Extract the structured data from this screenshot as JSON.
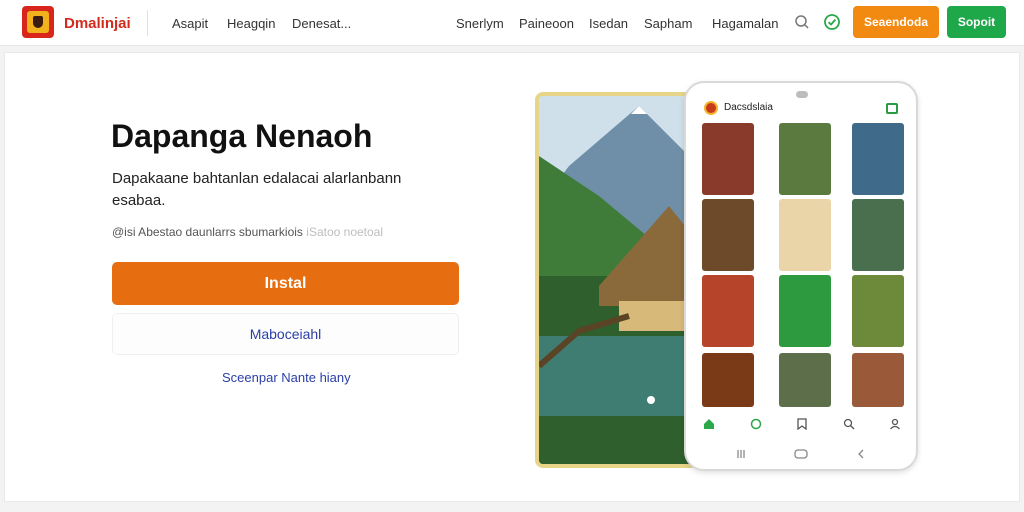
{
  "header": {
    "brand": "Dmalinjai",
    "links_left": [
      "Asapit",
      "Heagqin",
      "Denesat..."
    ],
    "links_right": [
      "Snerlym",
      "Paineoon",
      "Isedan",
      "Sapham",
      "Hagamalan"
    ],
    "cta_orange": "Seaendoda",
    "cta_green": "Sopoit"
  },
  "hero": {
    "title": "Dapanga Nenaoh",
    "description": "Dapakaane bahtanlan edalacai alarlanbann esabaa.",
    "meta_text": "@isi Abestao daunlarrs sbumarkiois",
    "meta_faded": "iSatoo noetoal",
    "install_label": "Instal",
    "secondary_label": "Maboceiahl",
    "link_label": "Sceenpar Nante hiany"
  },
  "phone": {
    "app_title": "Dacsdslaia"
  },
  "colors": {
    "brand_red": "#d42a1c",
    "install_orange": "#e66e10",
    "cta_orange": "#f28a12",
    "cta_green": "#1ea84a",
    "link_blue": "#2a3fa8",
    "photo_frame": "#e6d488"
  }
}
